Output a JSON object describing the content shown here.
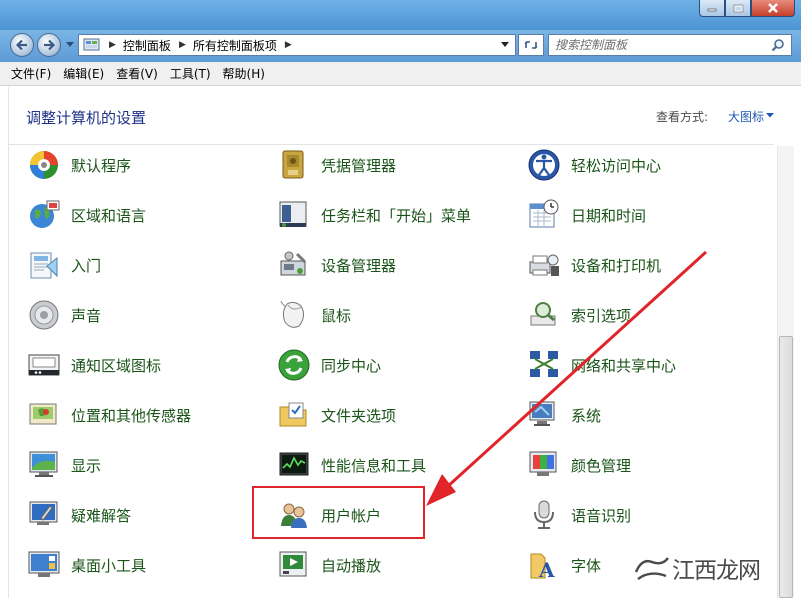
{
  "window": {
    "controls": {
      "minimize_icon": "minimize-icon",
      "maximize_icon": "maximize-icon",
      "close_icon": "close-icon"
    }
  },
  "address": {
    "crumbs": [
      "控制面板",
      "所有控制面板项"
    ],
    "search_placeholder": "搜索控制面板"
  },
  "menu": {
    "items": [
      "文件(F)",
      "编辑(E)",
      "查看(V)",
      "工具(T)",
      "帮助(H)"
    ]
  },
  "header": {
    "title": "调整计算机的设置",
    "view_by_label": "查看方式:",
    "view_by_value": "大图标"
  },
  "items": [
    {
      "label": "默认程序",
      "icon": "default-programs-icon"
    },
    {
      "label": "凭据管理器",
      "icon": "credential-manager-icon"
    },
    {
      "label": "轻松访问中心",
      "icon": "ease-of-access-icon"
    },
    {
      "label": "区域和语言",
      "icon": "region-language-icon"
    },
    {
      "label": "任务栏和「开始」菜单",
      "icon": "taskbar-start-menu-icon"
    },
    {
      "label": "日期和时间",
      "icon": "date-time-icon"
    },
    {
      "label": "入门",
      "icon": "getting-started-icon"
    },
    {
      "label": "设备管理器",
      "icon": "device-manager-icon"
    },
    {
      "label": "设备和打印机",
      "icon": "devices-printers-icon"
    },
    {
      "label": "声音",
      "icon": "sound-icon"
    },
    {
      "label": "鼠标",
      "icon": "mouse-icon"
    },
    {
      "label": "索引选项",
      "icon": "indexing-options-icon"
    },
    {
      "label": "通知区域图标",
      "icon": "notification-area-icon"
    },
    {
      "label": "同步中心",
      "icon": "sync-center-icon"
    },
    {
      "label": "网络和共享中心",
      "icon": "network-sharing-icon"
    },
    {
      "label": "位置和其他传感器",
      "icon": "location-sensors-icon"
    },
    {
      "label": "文件夹选项",
      "icon": "folder-options-icon"
    },
    {
      "label": "系统",
      "icon": "system-icon"
    },
    {
      "label": "显示",
      "icon": "display-icon"
    },
    {
      "label": "性能信息和工具",
      "icon": "performance-tools-icon"
    },
    {
      "label": "颜色管理",
      "icon": "color-management-icon"
    },
    {
      "label": "疑难解答",
      "icon": "troubleshooting-icon"
    },
    {
      "label": "用户帐户",
      "icon": "user-accounts-icon"
    },
    {
      "label": "语音识别",
      "icon": "speech-recognition-icon"
    },
    {
      "label": "桌面小工具",
      "icon": "desktop-gadgets-icon"
    },
    {
      "label": "自动播放",
      "icon": "autoplay-icon"
    },
    {
      "label": "字体",
      "icon": "fonts-icon"
    }
  ],
  "annotation": {
    "color": "#e0242a",
    "highlighted_item": "用户帐户"
  },
  "watermark": {
    "text": "江西龙网"
  }
}
